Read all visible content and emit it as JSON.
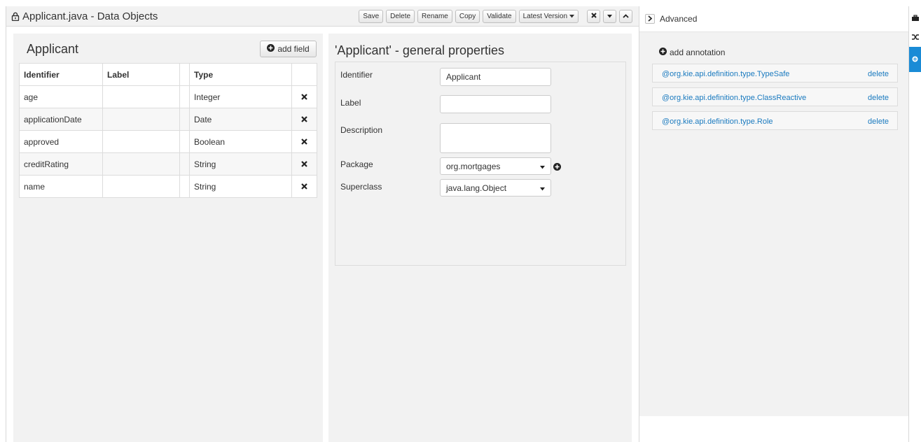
{
  "header": {
    "title": "Applicant.java - Data Objects",
    "buttons": {
      "save": "Save",
      "delete": "Delete",
      "rename": "Rename",
      "copy": "Copy",
      "validate": "Validate",
      "latest_version": "Latest Version"
    }
  },
  "left_panel": {
    "title": "Applicant",
    "add_field_label": "add field",
    "columns": [
      "Identifier",
      "Label",
      "",
      "Type",
      ""
    ],
    "rows": [
      {
        "identifier": "age",
        "label": "",
        "type": "Integer"
      },
      {
        "identifier": "applicationDate",
        "label": "",
        "type": "Date"
      },
      {
        "identifier": "approved",
        "label": "",
        "type": "Boolean"
      },
      {
        "identifier": "creditRating",
        "label": "",
        "type": "String"
      },
      {
        "identifier": "name",
        "label": "",
        "type": "String"
      }
    ]
  },
  "center_panel": {
    "title": "'Applicant' - general properties",
    "identifier_label": "Identifier",
    "identifier_value": "Applicant",
    "label_label": "Label",
    "label_value": "",
    "description_label": "Description",
    "description_value": "",
    "package_label": "Package",
    "package_value": "org.mortgages",
    "superclass_label": "Superclass",
    "superclass_value": "java.lang.Object"
  },
  "right_panel": {
    "title": "Advanced",
    "add_annotation_label": "add annotation",
    "annotations": [
      {
        "name": "@org.kie.api.definition.type.TypeSafe",
        "action": "delete"
      },
      {
        "name": "@org.kie.api.definition.type.ClassReactive",
        "action": "delete"
      },
      {
        "name": "@org.kie.api.definition.type.Role",
        "action": "delete"
      }
    ]
  },
  "colors": {
    "accent": "#1a8bd6",
    "link": "#1a7abf",
    "panel_bg": "#f2f2f2"
  }
}
